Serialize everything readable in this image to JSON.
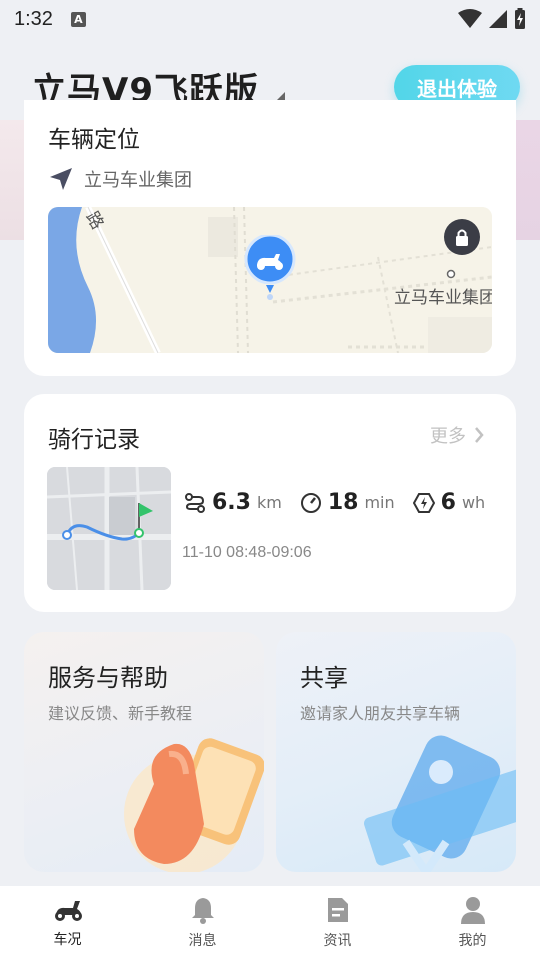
{
  "status_bar": {
    "time": "1:32",
    "notification_badge": "A"
  },
  "header": {
    "title": "立马V9飞跃版",
    "exit_button": "退出体验"
  },
  "location_card": {
    "title": "车辆定位",
    "address": "立马车业集团",
    "map": {
      "road_label": "路",
      "poi_label": "立马车业集团"
    }
  },
  "ride_card": {
    "title": "骑行记录",
    "more": "更多",
    "distance": {
      "value": "6.3",
      "unit": "km"
    },
    "duration": {
      "value": "18",
      "unit": "min"
    },
    "energy": {
      "value": "6",
      "unit": "wh"
    },
    "time_range": "11-10 08:48-09:06"
  },
  "features": [
    {
      "title": "服务与帮助",
      "subtitle": "建议反馈、新手教程"
    },
    {
      "title": "共享",
      "subtitle": "邀请家人朋友共享车辆"
    }
  ],
  "nav": [
    {
      "label": "车况",
      "icon": "scooter-icon",
      "active": true
    },
    {
      "label": "消息",
      "icon": "bell-icon",
      "active": false
    },
    {
      "label": "资讯",
      "icon": "document-icon",
      "active": false
    },
    {
      "label": "我的",
      "icon": "user-icon",
      "active": false
    }
  ],
  "colors": {
    "accent": "#52d6e8",
    "pin": "#3d8df5"
  }
}
